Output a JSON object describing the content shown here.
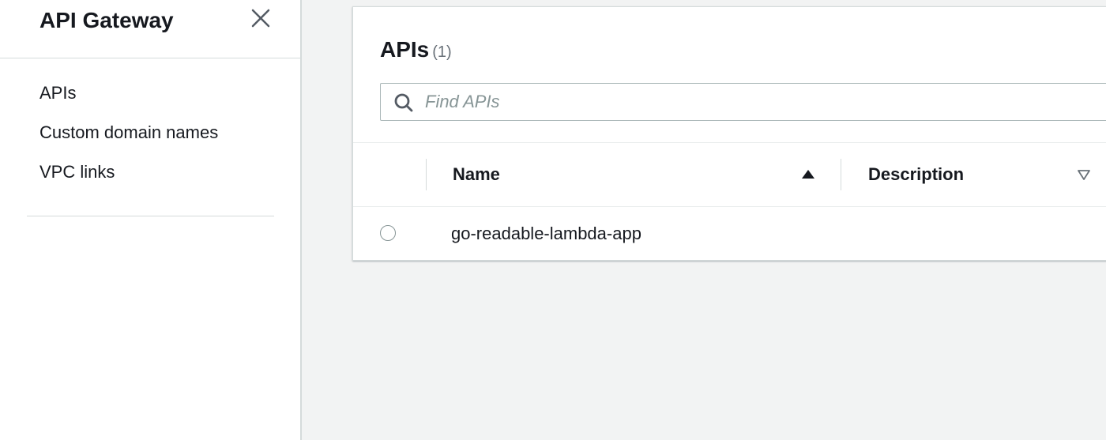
{
  "sidebar": {
    "title": "API Gateway",
    "close_icon": "close-icon",
    "items": [
      {
        "label": "APIs"
      },
      {
        "label": "Custom domain names"
      },
      {
        "label": "VPC links"
      }
    ]
  },
  "panel": {
    "title": "APIs",
    "count": "(1)",
    "search": {
      "placeholder": "Find APIs",
      "value": "",
      "icon": "search-icon"
    },
    "columns": [
      {
        "label": "Name",
        "sort": "ascending",
        "sort_icon": "sort-ascending-icon"
      },
      {
        "label": "Description",
        "sort": "none",
        "sort_icon": "sort-descending-outline-icon"
      }
    ],
    "rows": [
      {
        "name": "go-readable-lambda-app",
        "description": "",
        "selected": false
      }
    ]
  },
  "colors": {
    "text": "#16191f",
    "muted": "#687078",
    "border": "#d5dbdb",
    "background": "#f2f3f3"
  }
}
